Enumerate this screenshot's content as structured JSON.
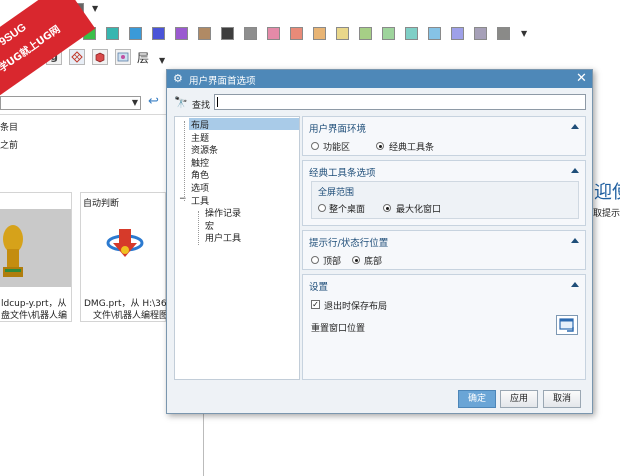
{
  "watermark": {
    "line1": "9SUG",
    "line2": "学UG就上UG网"
  },
  "palette": {
    "row1": [
      "#2b2b2b",
      "#ffffff",
      "#666666"
    ],
    "row2": [
      "#e23a2e",
      "#e6d43a",
      "#3bbf4a",
      "#37b6b0",
      "#3a9ad8",
      "#4a54d8",
      "#9a5ad0",
      "#b08a64",
      "#3e3e3e",
      "#8e8e8e",
      "#e48aa8",
      "#e88a78",
      "#e8b474",
      "#e9d78a",
      "#a6cf86",
      "#9ed49c",
      "#7fcfc6",
      "#86c3e6",
      "#9ea0e8",
      "#a6a0b8",
      "#8a8a88"
    ],
    "layer_label": "层"
  },
  "background_app": {
    "item1": "条目",
    "item2": "之前",
    "card1_name": "ldcup-y.prt，从",
    "card1_path": "盘文件\\机器人编",
    "card2_title": "自动判断",
    "card2_name": "DMG.prt，从 H:\\36(",
    "card2_path": "文件\\机器人编程图",
    "right_big": "迎使",
    "right_small": "取提示"
  },
  "dialog": {
    "title": "用户界面首选项",
    "search_label": "查找",
    "search_value": "",
    "tree": [
      {
        "label": "布局",
        "level": 0,
        "selected": true
      },
      {
        "label": "主题",
        "level": 0
      },
      {
        "label": "资源条",
        "level": 0
      },
      {
        "label": "触控",
        "level": 0
      },
      {
        "label": "角色",
        "level": 0
      },
      {
        "label": "选项",
        "level": 0
      },
      {
        "label": "工具",
        "level": 0,
        "expander": "−"
      },
      {
        "label": "操作记录",
        "level": 1
      },
      {
        "label": "宏",
        "level": 1
      },
      {
        "label": "用户工具",
        "level": 1
      }
    ],
    "ui_env": {
      "title": "用户界面环境",
      "options": [
        "功能区",
        "经典工具条"
      ],
      "selected": 1
    },
    "classic_toolbar": {
      "title": "经典工具条选项",
      "group_title": "全屏范围",
      "options": [
        "整个桌面",
        "最大化窗口"
      ],
      "selected": 1
    },
    "prompt_pos": {
      "title": "提示行/状态行位置",
      "options": [
        "顶部",
        "底部"
      ],
      "selected": 1
    },
    "settings": {
      "title": "设置",
      "save_layout_label": "退出时保存布局",
      "save_layout_checked": true,
      "reset_window_label": "重置窗口位置"
    },
    "buttons": {
      "ok": "确定",
      "apply": "应用",
      "cancel": "取消"
    }
  }
}
